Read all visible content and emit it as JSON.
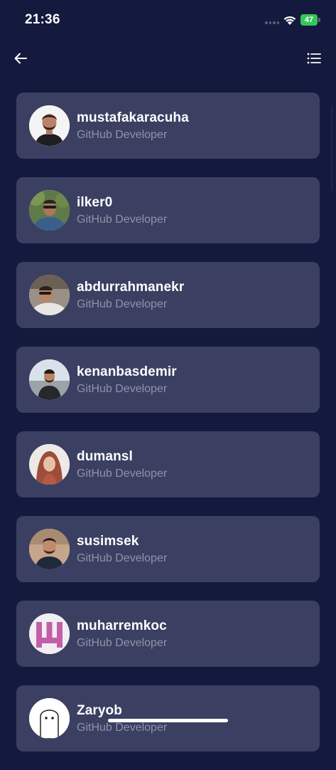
{
  "status_bar": {
    "time": "21:36",
    "battery": "47",
    "icons": [
      "signal-icon",
      "wifi-icon",
      "battery-icon"
    ]
  },
  "header": {
    "back_icon": "arrow-left-icon",
    "menu_icon": "list-icon"
  },
  "colors": {
    "background": "#141a3d",
    "card": "#3b4062",
    "role_text": "#8e93aa",
    "battery": "#34c759"
  },
  "users": [
    {
      "username": "mustafakaracuha",
      "role": "GitHub Developer"
    },
    {
      "username": "ilker0",
      "role": "GitHub Developer"
    },
    {
      "username": "abdurrahmanekr",
      "role": "GitHub Developer"
    },
    {
      "username": "kenanbasdemir",
      "role": "GitHub Developer"
    },
    {
      "username": "dumansl",
      "role": "GitHub Developer"
    },
    {
      "username": "susimsek",
      "role": "GitHub Developer"
    },
    {
      "username": "muharremkoc",
      "role": "GitHub Developer"
    },
    {
      "username": "Zaryob",
      "role": "GitHub Developer"
    }
  ]
}
